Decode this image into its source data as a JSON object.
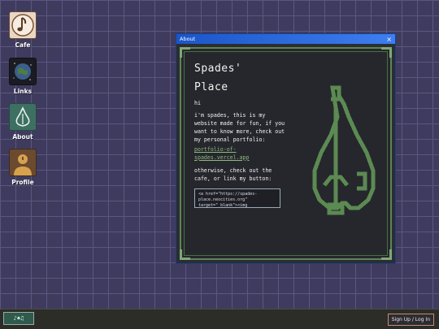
{
  "desktop": {
    "icons": [
      {
        "label": "Cafe"
      },
      {
        "label": "Links"
      },
      {
        "label": "About"
      },
      {
        "label": "Profile"
      }
    ]
  },
  "window": {
    "title": "About",
    "close_glyph": "×",
    "heading_line1": "Spades'",
    "heading_line2": "Place",
    "greeting": "hi",
    "intro": "i'm spades, this is my website made for fun, if you want to know more, check out my personal portfolio:",
    "portfolio_link": "portfolio-of-spades.vercel.app",
    "outro": "otherwise, check out the cafe, or link my button:",
    "code_snippet": "<a href=\"https://spades-place.neocities.org\" target=\"_blank\"><img"
  },
  "taskbar": {
    "start_glyph": "♪♠♫",
    "signup_label": "Sign Up / Log In"
  },
  "colors": {
    "desktop_bg": "#3f3b5e",
    "titlebar": "#1b56c9",
    "frame_green": "#5d8455",
    "pear_green": "#5b8a52"
  }
}
